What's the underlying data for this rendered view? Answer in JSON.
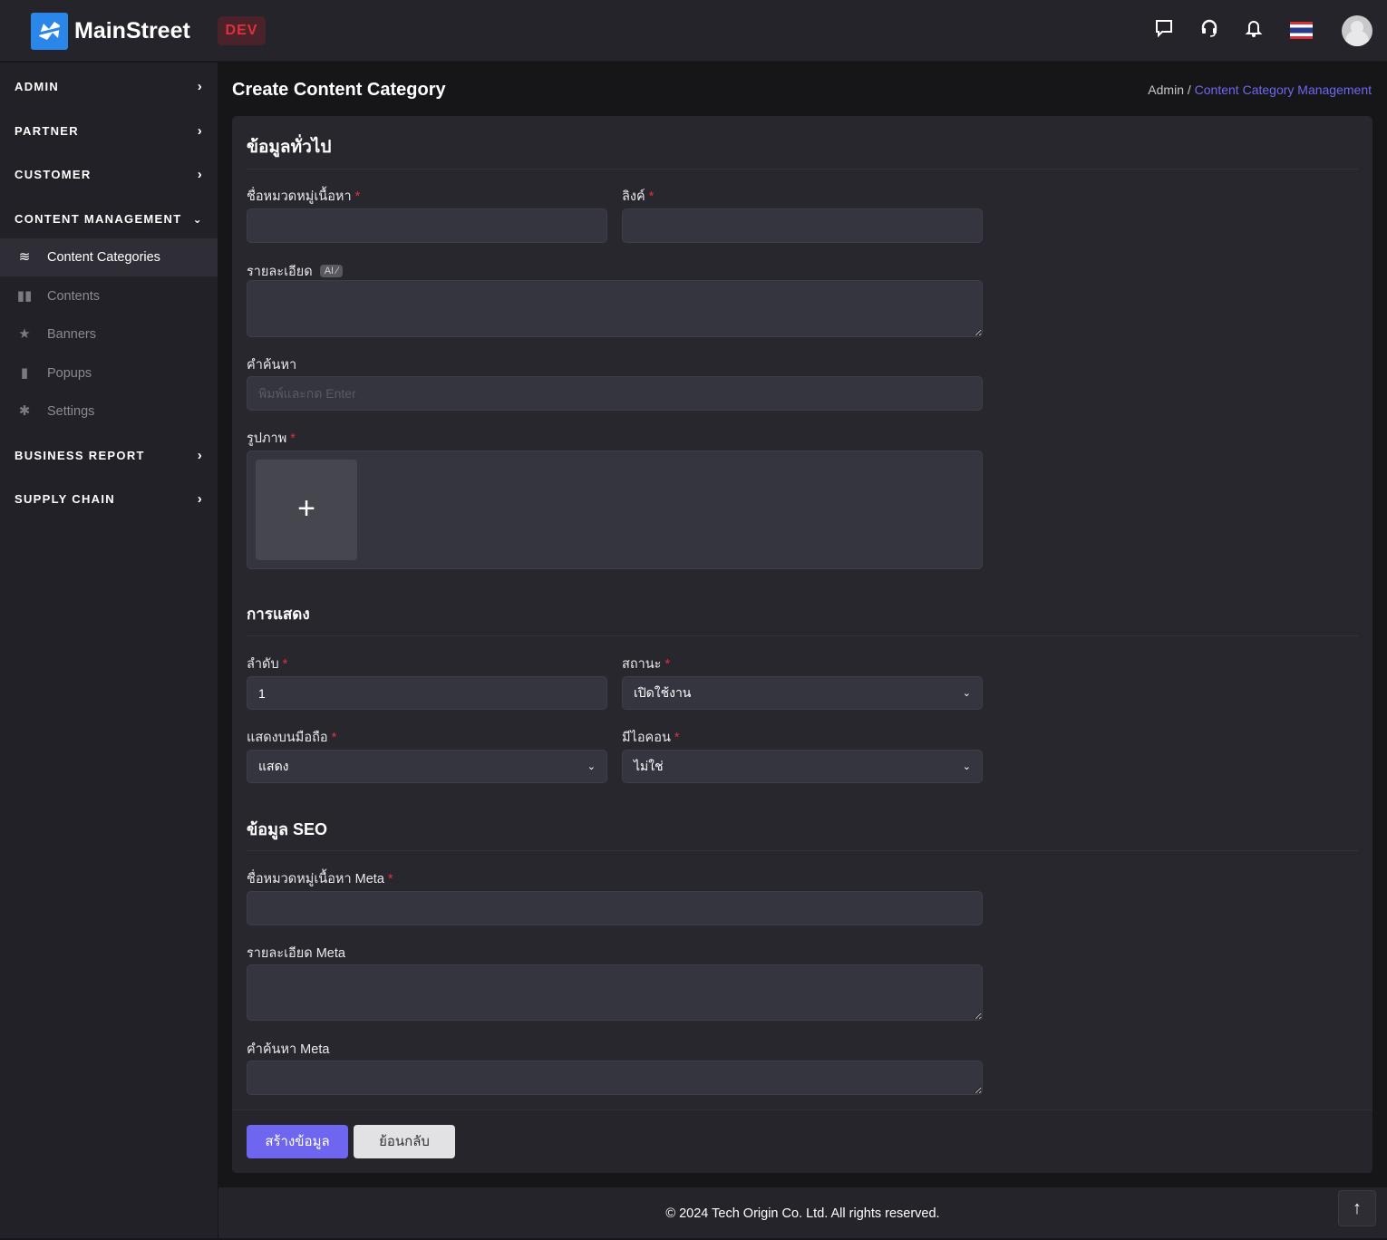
{
  "header": {
    "brand": "MainStreet",
    "env_badge": "DEV",
    "icons": [
      "chat-icon",
      "headset-icon",
      "bell-icon",
      "thai-flag-icon",
      "avatar-icon"
    ]
  },
  "sidebar": {
    "sections": [
      {
        "label": "ADMIN"
      },
      {
        "label": "PARTNER"
      },
      {
        "label": "CUSTOMER"
      },
      {
        "label": "CONTENT MANAGEMENT",
        "expanded": true
      },
      {
        "label": "BUSINESS REPORT"
      },
      {
        "label": "SUPPLY CHAIN"
      }
    ],
    "items": [
      {
        "label": "Content Categories",
        "icon": "layers-icon",
        "active": true
      },
      {
        "label": "Contents",
        "icon": "book-icon"
      },
      {
        "label": "Banners",
        "icon": "star-icon"
      },
      {
        "label": "Popups",
        "icon": "clipboard-icon"
      },
      {
        "label": "Settings",
        "icon": "gear-icon"
      }
    ]
  },
  "page": {
    "title": "Create Content Category",
    "breadcrumb": {
      "root": "Admin",
      "sep": "/",
      "current": "Content Category Management"
    }
  },
  "form": {
    "general": {
      "heading": "ข้อมูลทั่วไป",
      "name_label": "ชื่อหมวดหมู่เนื้อหา",
      "link_label": "ลิงค์",
      "desc_label": "รายละเอียด",
      "ai_badge": "AI ⁄",
      "keywords_label": "คำค้นหา",
      "keywords_placeholder": "พิมพ์และกด Enter",
      "image_label": "รูปภาพ",
      "add_symbol": "+"
    },
    "display": {
      "heading": "การแสดง",
      "order_label": "ลำดับ",
      "order_value": "1",
      "status_label": "สถานะ",
      "status_value": "เปิดใช้งาน",
      "mobile_label": "แสดงบนมือถือ",
      "mobile_value": "แสดง",
      "icon_label": "มีไอคอน",
      "icon_value": "ไม่ใช่"
    },
    "seo": {
      "heading": "ข้อมูล SEO",
      "meta_name_label": "ชื่อหมวดหมู่เนื้อหา Meta",
      "meta_desc_label": "รายละเอียด Meta",
      "meta_keywords_label": "คำค้นหา Meta"
    },
    "required_mark": "*",
    "buttons": {
      "create": "สร้างข้อมูล",
      "back": "ย้อนกลับ"
    }
  },
  "footer": {
    "copyright": "© 2024 Tech Origin Co. Ltd. All rights reserved.",
    "top_arrow": "↑"
  },
  "colors": {
    "accent": "#6e66ee",
    "required": "#e0303e",
    "dev_badge": "#e0303e",
    "brand_logo": "#2a86e8"
  }
}
